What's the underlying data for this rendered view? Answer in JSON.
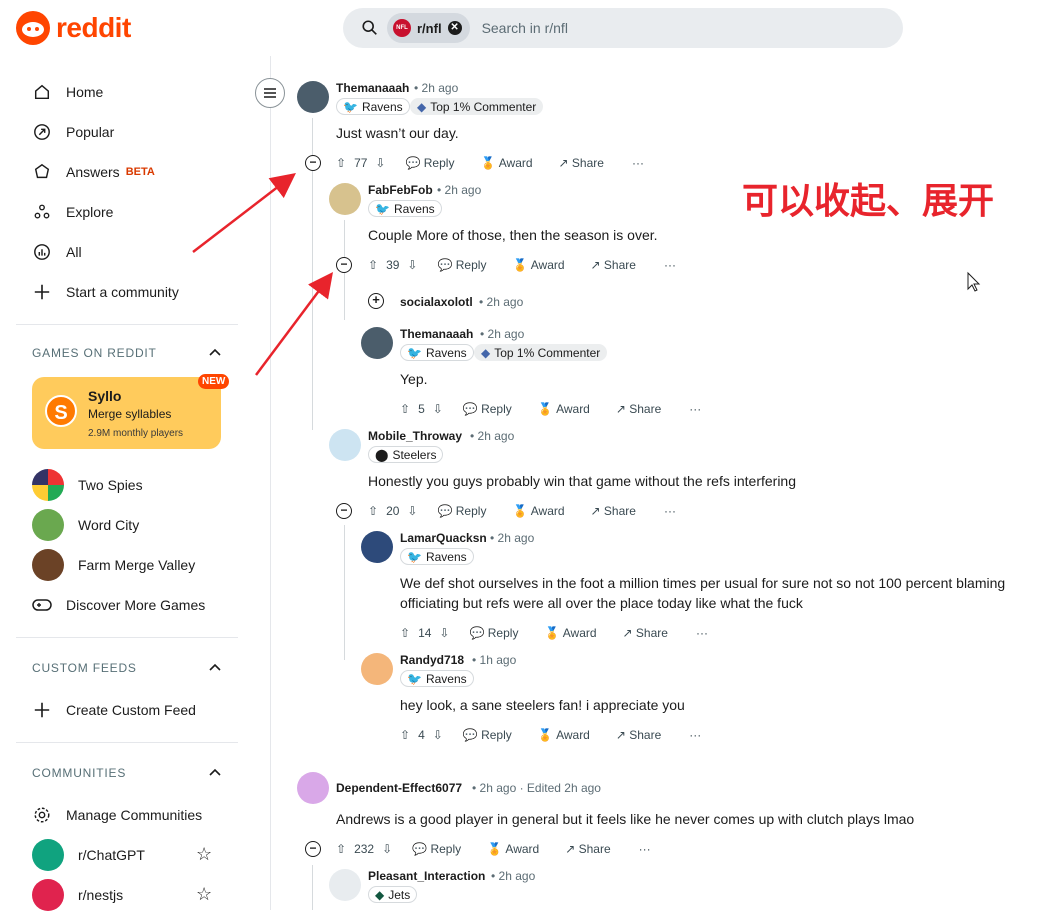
{
  "header": {
    "logo_text": "reddit",
    "search_chip": "r/nfl",
    "search_placeholder": "Search in r/nfl"
  },
  "sidebar": {
    "nav": [
      {
        "label": "Home",
        "icon": "home-icon"
      },
      {
        "label": "Popular",
        "icon": "popular-icon"
      },
      {
        "label": "Answers",
        "badge": "BETA",
        "icon": "answers-icon"
      },
      {
        "label": "Explore",
        "icon": "explore-icon"
      },
      {
        "label": "All",
        "icon": "all-icon"
      },
      {
        "label": "Start a community",
        "icon": "plus-icon"
      }
    ],
    "games_header": "GAMES ON REDDIT",
    "featured_game": {
      "name": "Syllo",
      "subtitle": "Merge syllables",
      "meta": "2.9M monthly players",
      "badge": "NEW"
    },
    "games": [
      "Two Spies",
      "Word City",
      "Farm Merge Valley",
      "Discover More Games"
    ],
    "custom_feeds_header": "CUSTOM FEEDS",
    "create_custom_feed": "Create Custom Feed",
    "communities_header": "COMMUNITIES",
    "manage_communities": "Manage Communities",
    "communities": [
      "r/ChatGPT",
      "r/nestjs"
    ]
  },
  "comments": [
    {
      "user": "Themanaaah",
      "time": "2h ago",
      "flair": "Ravens",
      "badge": "Top 1% Commenter",
      "body": "Just wasn’t our day.",
      "votes": "77"
    },
    {
      "user": "FabFebFob",
      "time": "2h ago",
      "flair": "Ravens",
      "body": "Couple More of those, then the season is over.",
      "votes": "39"
    },
    {
      "user": "socialaxolotl",
      "time": "2h ago"
    },
    {
      "user": "Themanaaah",
      "time": "2h ago",
      "flair": "Ravens",
      "badge": "Top 1% Commenter",
      "body": "Yep.",
      "votes": "5"
    },
    {
      "user": "Mobile_Throway",
      "time": "2h ago",
      "flair": "Steelers",
      "body": "Honestly you guys probably win that game without the refs interfering",
      "votes": "20"
    },
    {
      "user": "LamarQuacksn",
      "time": "2h ago",
      "flair": "Ravens",
      "body1": "We def shot ourselves in the foot a million times per usual for sure not so not 100 percent blaming",
      "body2": "officiating but refs were all over the place today like what the fuck",
      "votes": "14"
    },
    {
      "user": "Randyd718",
      "time": "1h ago",
      "flair": "Ravens",
      "body": "hey look, a sane steelers fan! i appreciate you",
      "votes": "4"
    },
    {
      "user": "Dependent-Effect6077",
      "time": "2h ago · Edited 2h ago",
      "body": "Andrews is a good player in general but it feels like he never comes up with clutch plays lmao",
      "votes": "232"
    },
    {
      "user": "Pleasant_Interaction",
      "time": "2h ago",
      "flair": "Jets"
    }
  ],
  "actions": {
    "reply": "Reply",
    "award": "Award",
    "share": "Share",
    "more": "···"
  },
  "annotation": "可以收起、展开"
}
